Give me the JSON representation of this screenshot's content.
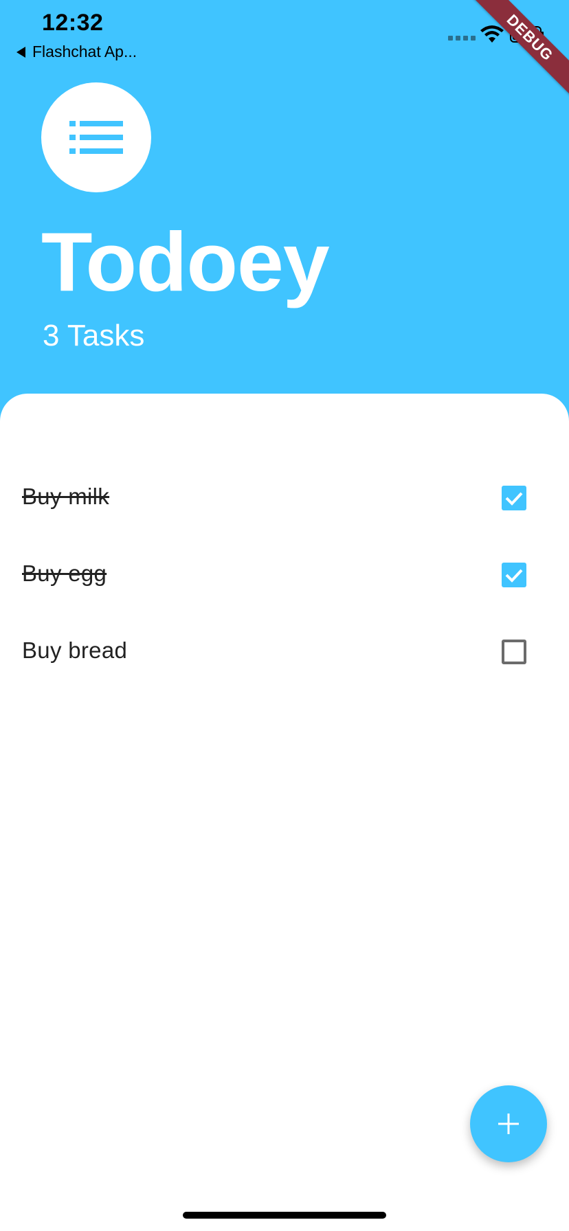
{
  "status_bar": {
    "time": "12:32",
    "back_app": "Flashchat Ap..."
  },
  "debug_banner": "DEBUG",
  "header": {
    "icon": "list-icon",
    "title": "Todoey",
    "task_count": "3 Tasks"
  },
  "tasks": [
    {
      "title": "Buy milk",
      "done": true
    },
    {
      "title": "Buy egg",
      "done": true
    },
    {
      "title": "Buy bread",
      "done": false
    }
  ],
  "fab": {
    "icon": "plus-icon"
  },
  "colors": {
    "accent": "#40C4FF",
    "checkbox_border": "#6b6b6b",
    "debug_banner": "#8B2E3C"
  }
}
